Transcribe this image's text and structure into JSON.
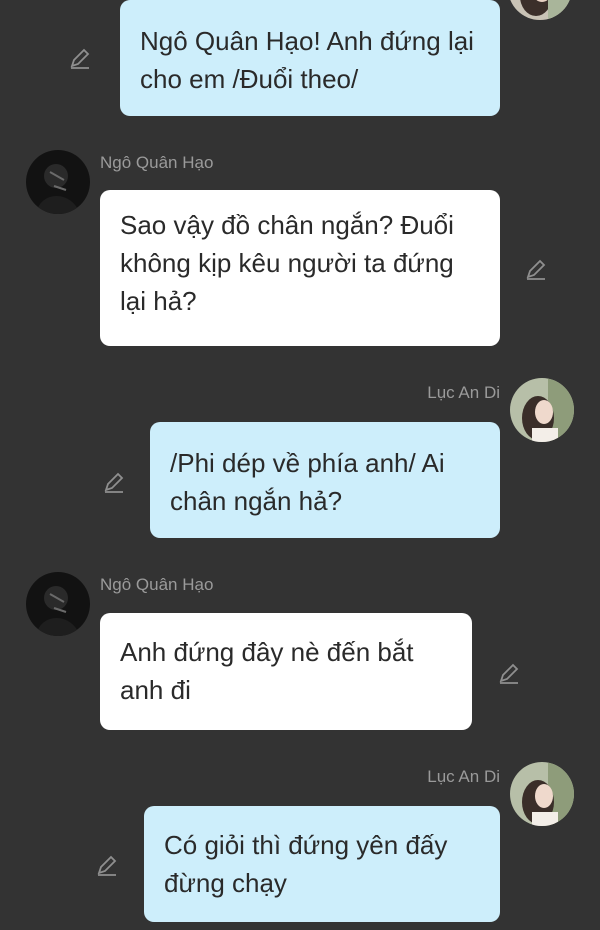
{
  "messages": [
    {
      "sender": "",
      "side": "right",
      "text": "Ngô Quân Hạo! Anh đứng lại cho em /Đuổi theo/"
    },
    {
      "sender": "Ngô Quân Hạo",
      "side": "left",
      "text": "Sao vậy đồ chân ngắn? Đuổi không kịp kêu người ta đứng lại hả?"
    },
    {
      "sender": "Lục An Di",
      "side": "right",
      "text": "/Phi dép về phía anh/ Ai chân ngắn hả?"
    },
    {
      "sender": "Ngô Quân Hạo",
      "side": "left",
      "text": "Anh đứng đây nè đến bắt anh đi"
    },
    {
      "sender": "Lục An Di",
      "side": "right",
      "text": "Có giỏi thì đứng yên đấy đừng chạy"
    }
  ],
  "colors": {
    "background": "#333333",
    "my_bubble": "#cdeefb",
    "their_bubble": "#ffffff",
    "sender_name": "#9a9a9a",
    "edit_icon": "#8f8f8f"
  },
  "icons": {
    "edit": "pencil-icon"
  }
}
